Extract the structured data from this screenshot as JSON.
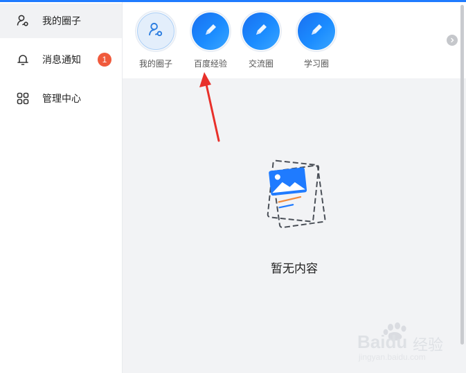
{
  "sidebar": {
    "items": [
      {
        "label": "我的圈子",
        "icon": "circle-people-icon",
        "active": true
      },
      {
        "label": "消息通知",
        "icon": "bell-icon",
        "badge": "1"
      },
      {
        "label": "管理中心",
        "icon": "grid-icon"
      }
    ]
  },
  "circles": {
    "items": [
      {
        "label": "我的圈子",
        "icon": "circle-people-icon"
      },
      {
        "label": "百度经验",
        "icon": "pencil-icon"
      },
      {
        "label": "交流圈",
        "icon": "pencil-icon"
      },
      {
        "label": "学习圈",
        "icon": "pencil-icon"
      }
    ],
    "next_icon": "chevron-right-icon"
  },
  "empty_state": {
    "text": "暂无内容",
    "icon": "image-document-icon"
  },
  "watermark": {
    "brand": "Baidu",
    "product": "经验",
    "url": "jingyan.baidu.com"
  },
  "colors": {
    "accent": "#1f7bff",
    "badge": "#f05a3c",
    "arrow": "#e8302a",
    "background": "#f2f3f5"
  }
}
